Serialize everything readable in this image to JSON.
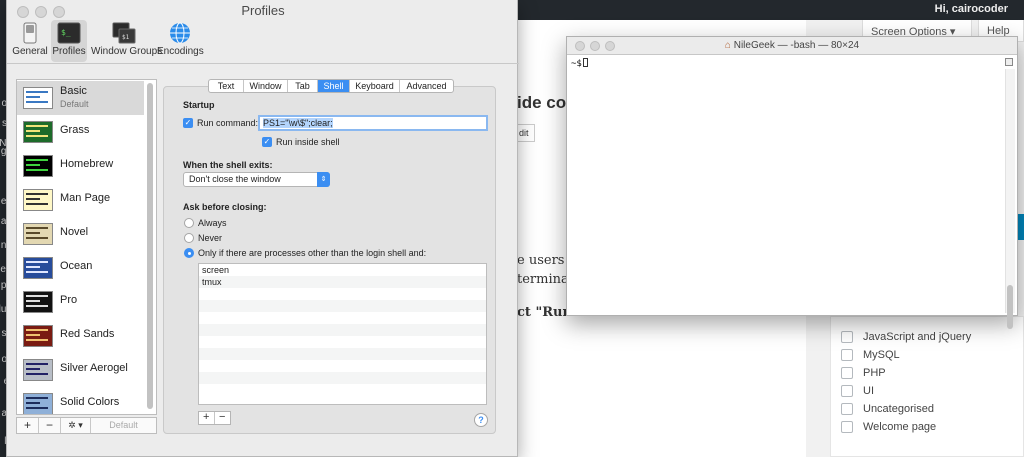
{
  "wp": {
    "greeting": "Hi, cairocoder",
    "screen_options": "Screen Options ▾",
    "help": "Help ▾",
    "hidden_texts": [
      "ide con",
      "dit",
      "e users wh",
      "terminal",
      "ct \"Run c"
    ],
    "categories": [
      "JavaScript and jQuery",
      "MySQL",
      "PHP",
      "UI",
      "Uncategorised",
      "Welcome page"
    ],
    "sidebar_fragments": [
      "os",
      "sti",
      "Ne",
      "go",
      "ed",
      "ag",
      "no",
      "ert",
      "pp",
      "lug",
      "se",
      "oc",
      "et",
      "ac",
      "lp"
    ]
  },
  "prefs": {
    "title": "Profiles",
    "toolbar": [
      {
        "label": "General",
        "icon": "switch-icon"
      },
      {
        "label": "Profiles",
        "icon": "terminal-icon"
      },
      {
        "label": "Window Groups",
        "icon": "window-groups-icon"
      },
      {
        "label": "Encodings",
        "icon": "globe-icon"
      }
    ],
    "profiles": [
      {
        "name": "Basic",
        "subtitle": "Default"
      },
      {
        "name": "Grass"
      },
      {
        "name": "Homebrew"
      },
      {
        "name": "Man Page"
      },
      {
        "name": "Novel"
      },
      {
        "name": "Ocean"
      },
      {
        "name": "Pro"
      },
      {
        "name": "Red Sands"
      },
      {
        "name": "Silver Aerogel"
      },
      {
        "name": "Solid Colors"
      }
    ],
    "list_buttons": {
      "add": "+",
      "remove": "−",
      "action": "✲ ▾",
      "default": "Default"
    },
    "tabs": [
      "Text",
      "Window",
      "Tab",
      "Shell",
      "Keyboard",
      "Advanced"
    ],
    "startup": {
      "heading": "Startup",
      "run_command_label": "Run command:",
      "run_command_value": "PS1=\"\\w\\$\";clear;",
      "run_inside_shell": "Run inside shell"
    },
    "shell_exit": {
      "heading": "When the shell exits:",
      "selected": "Don't close the window"
    },
    "ask_closing": {
      "heading": "Ask before closing:",
      "always": "Always",
      "never": "Never",
      "only_if": "Only if there are processes other than the login shell and:",
      "processes": [
        "screen",
        "tmux",
        "",
        "",
        "",
        "",
        "",
        "",
        "",
        "",
        ""
      ]
    },
    "proc_buttons": {
      "add": "+",
      "remove": "−"
    },
    "help_label": "?"
  },
  "terminal": {
    "title": "NileGeek — -bash — 80×24",
    "prompt": "~$"
  }
}
